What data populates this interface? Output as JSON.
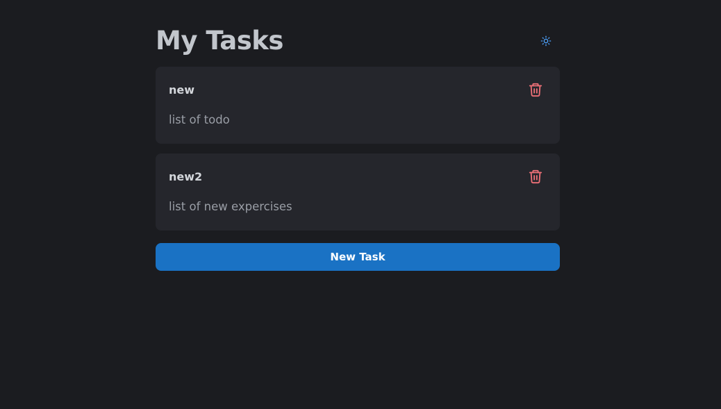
{
  "header": {
    "title": "My Tasks",
    "theme_toggle_icon": "sun-icon"
  },
  "tasks": [
    {
      "title": "new",
      "description": "list of todo",
      "delete_icon": "trash-icon"
    },
    {
      "title": "new2",
      "description": "list of new expercises",
      "delete_icon": "trash-icon"
    }
  ],
  "actions": {
    "new_task_label": "New Task"
  },
  "colors": {
    "background": "#1b1c20",
    "card": "#25262c",
    "accent": "#1a72c4",
    "danger": "#f07178",
    "toggle": "#4da3ff"
  }
}
